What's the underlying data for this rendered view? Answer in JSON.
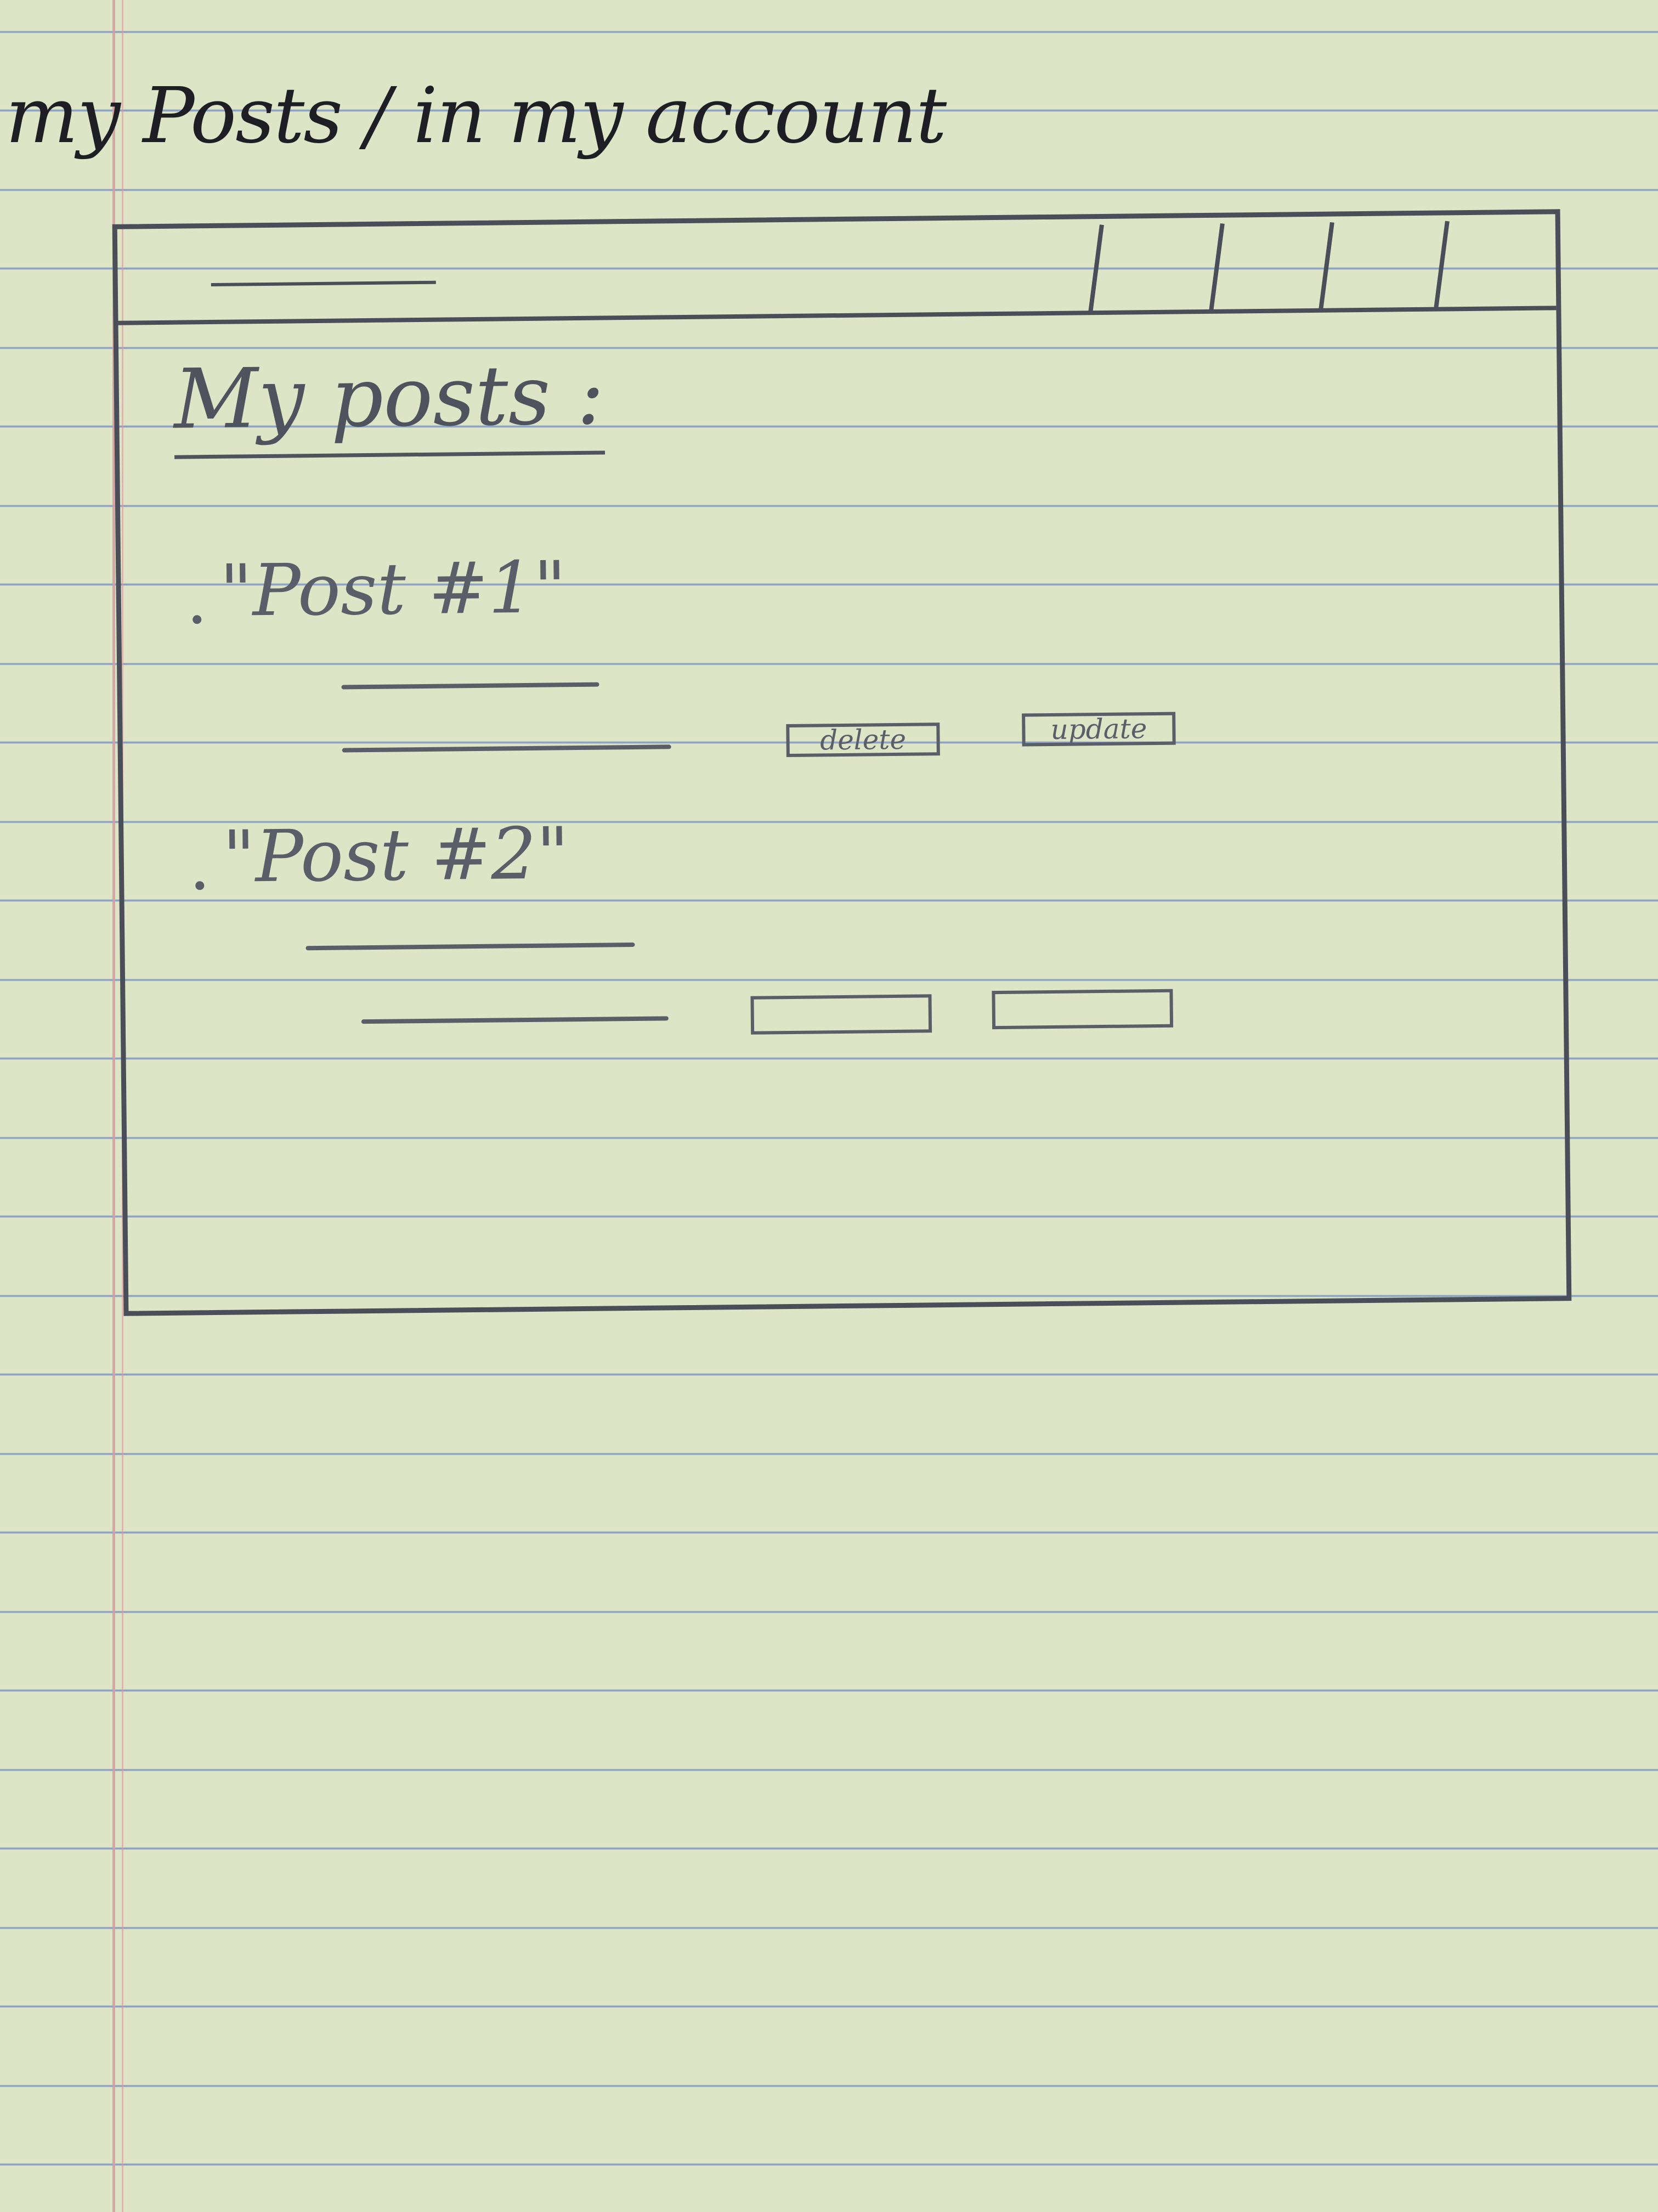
{
  "caption": "my Posts / in my account",
  "header": {
    "nav_items": [
      "",
      "",
      "",
      ""
    ]
  },
  "main": {
    "title": "My posts :",
    "posts": [
      {
        "title": "\"Post #1\"",
        "buttons": [
          "delete",
          "update"
        ]
      },
      {
        "title": "\"Post #2\"",
        "buttons": [
          "",
          ""
        ]
      }
    ]
  },
  "colors": {
    "paper": "#dde5c6",
    "ruled_line": "#8a9fc4",
    "margin_line": "#d89aa0",
    "pencil": "#4a4e58"
  }
}
